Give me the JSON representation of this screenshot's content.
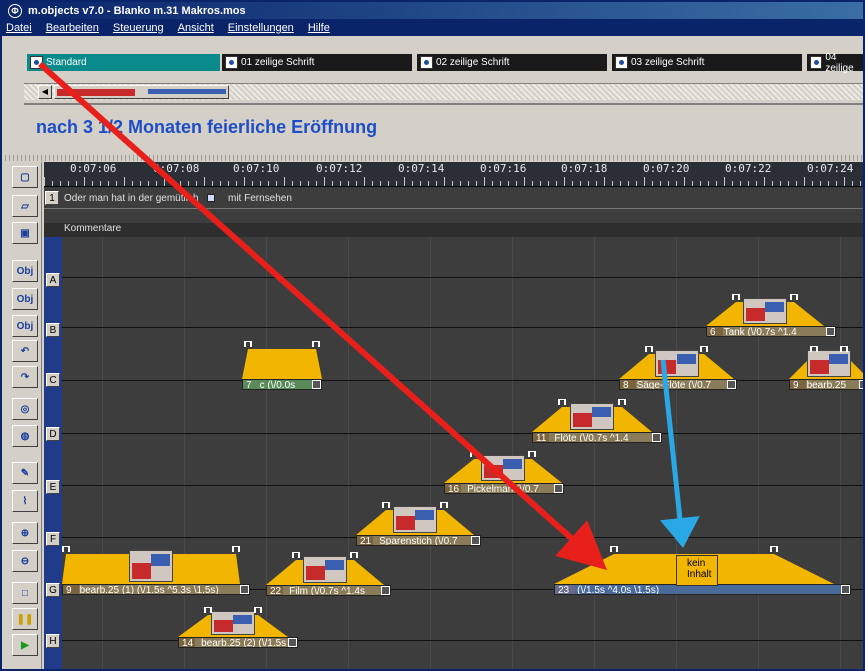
{
  "window": {
    "title": "m.objects v7.0 - Blanko m.31 Makros.mos",
    "title_icon": "mobjects-logo-icon"
  },
  "menu": [
    "Datei",
    "Bearbeiten",
    "Steuerung",
    "Ansicht",
    "Einstellungen",
    "Hilfe"
  ],
  "style_buttons": [
    "Standard",
    "01 zeilige Schrift",
    "02 zeilige Schrift",
    "03 zeilige Schrift",
    "04 zeilige"
  ],
  "headline": "nach 3 1/2 Monaten feierliche Eröffnung",
  "ruler_times": [
    "0:07:06",
    "0:07:08",
    "0:07:10",
    "0:07:12",
    "0:07:14",
    "0:07:16",
    "0:07:18",
    "0:07:20",
    "0:07:22",
    "0:07:24"
  ],
  "track1": {
    "number": "1",
    "text": "Oder man hat in der gemütlich",
    "text2": "mit Fernsehen",
    "comments_label": "Kommentare"
  },
  "rows": [
    "A",
    "B",
    "C",
    "D",
    "E",
    "F",
    "G",
    "H"
  ],
  "objects": {
    "tank": "Tank (\\/0.7s ^1.4",
    "six": "6",
    "saege": "Säge-Flöte (\\/0.7",
    "eight": "8",
    "nine": "9",
    "bearb_c": "bearb.25",
    "c_obj": "c (\\/0.0s",
    "seven": "7",
    "floete": "Flöte (\\/0.7s ^1.4",
    "eleven": "11",
    "pickelman": "Pickelman (\\/0.7",
    "sixteen": "16",
    "sparen": "Sparenstich (\\/0.7",
    "twentyone": "21",
    "bearb_g": "bearb.25 (1) (\\/1.5s ^5.3s \\1.5s)",
    "film": "Film (\\/0.7s ^1.4s",
    "twentytwo": "22",
    "obj23": "(\\/1.5s ^4.0s \\1.5s)",
    "twentythree": "23",
    "kein_inhalt": "kein Inhalt",
    "bearb_h": "bearb.25 (2) (\\/1.5s",
    "fourteen": "14"
  },
  "toolbar_icons": [
    "new-file-icon",
    "open-folder-icon",
    "save-icon",
    "new-object-icon",
    "object-question-icon",
    "object-icon",
    "undo-icon",
    "redo-icon",
    "color-wheel-icon",
    "palette-icon",
    "pencil-icon",
    "eyedropper-icon",
    "zoom-in-icon",
    "zoom-out-icon",
    "stop-icon",
    "pause-icon",
    "play-icon"
  ],
  "colors": {
    "accent": "#0a246a",
    "object": "#f2b500",
    "arrow_red": "#e8201c",
    "arrow_blue": "#2aa8e6",
    "headline": "#1d4ec8"
  }
}
